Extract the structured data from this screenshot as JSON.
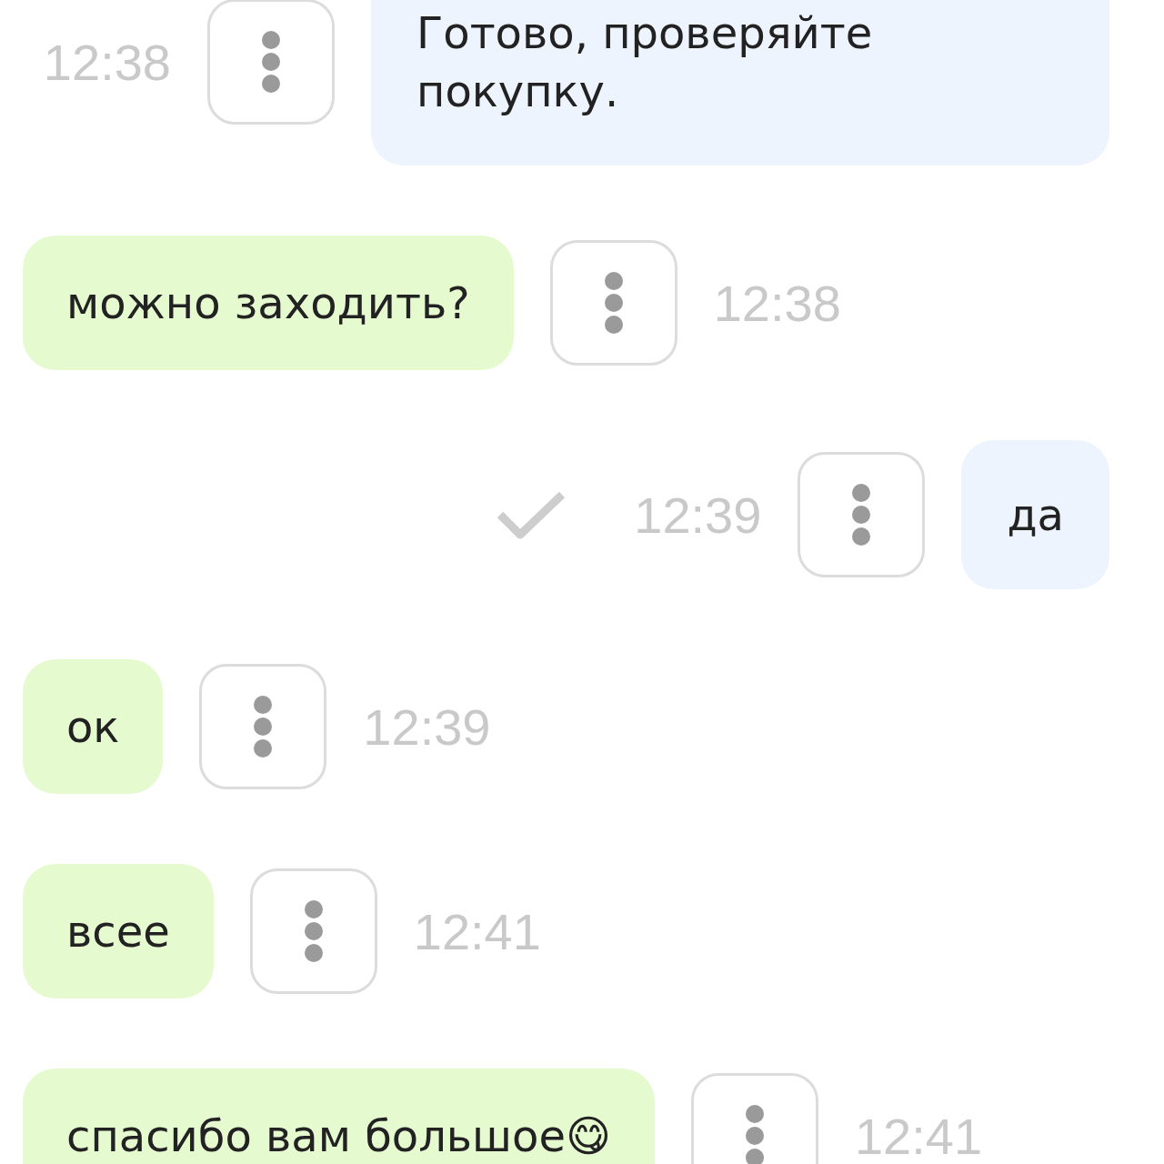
{
  "messages": [
    {
      "kind": "outgoing",
      "text": "Готово, проверяйте покупку.",
      "time": "12:38",
      "read": false
    },
    {
      "kind": "incoming",
      "text": "можно заходить?",
      "time": "12:38",
      "read": false
    },
    {
      "kind": "outgoing",
      "text": "да",
      "time": "12:39",
      "read": true
    },
    {
      "kind": "incoming",
      "text": "ок",
      "time": "12:39",
      "read": false
    },
    {
      "kind": "incoming",
      "text": "всее",
      "time": "12:41",
      "read": false
    },
    {
      "kind": "incoming",
      "text": "спасибо вам большое😋",
      "time": "12:41",
      "read": false
    }
  ]
}
